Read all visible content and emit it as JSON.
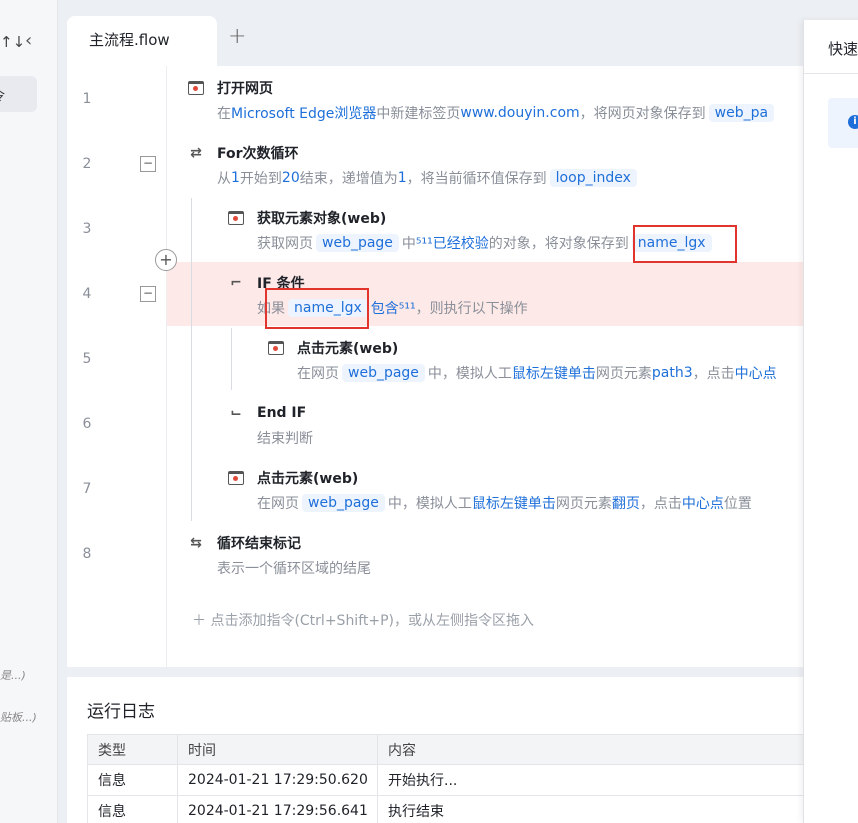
{
  "sidebar": {
    "sort_icon": "↑↓",
    "back_icon": "‹",
    "active_item": "令",
    "hint1": "是...)",
    "hint2": "贴板...)"
  },
  "tabs": [
    {
      "label": "主流程.flow"
    }
  ],
  "tab_add": "+",
  "steps": [
    {
      "line": "1",
      "title": "打开网页",
      "icon": "browser-open-icon",
      "desc": {
        "a": "在",
        "b": "Microsoft Edge浏览器",
        "c": "中新建标签页",
        "d": "www.douyin.com",
        "e": "，将网页对象保存到",
        "f": "web_pa"
      }
    },
    {
      "line": "2",
      "title": "For次数循环",
      "icon": "loop-icon",
      "desc": {
        "a": "从",
        "b": "1",
        "c": "开始到",
        "d": "20",
        "e": "结束，递增值为",
        "f": "1",
        "g": "，将当前循环值保存到",
        "h": "loop_index"
      }
    },
    {
      "line": "3",
      "title": "获取元素对象(web)",
      "icon": "web-element-icon",
      "desc": {
        "a": "获取网页",
        "b": "web_page",
        "c": "中",
        "d": "⁵¹¹已经校验",
        "e": "的对象，将对象保存到",
        "f": "name_lgx"
      }
    },
    {
      "line": "4",
      "title": "IF 条件",
      "icon": "if-condition-icon",
      "desc": {
        "a": "如果",
        "b": "name_lgx",
        "c": "包含⁵¹¹",
        "d": "，则执行以下操作"
      }
    },
    {
      "line": "5",
      "title": "点击元素(web)",
      "icon": "click-element-icon",
      "desc": {
        "a": "在网页",
        "b": "web_page",
        "c": "中，模拟人工",
        "d": "鼠标左键单击",
        "e": "网页元素",
        "f": "path3",
        "g": "，点击",
        "h": "中心点"
      }
    },
    {
      "line": "6",
      "title": "End IF",
      "icon": "end-if-icon",
      "desc": {
        "a": "结束判断"
      }
    },
    {
      "line": "7",
      "title": "点击元素(web)",
      "icon": "click-element-icon",
      "desc": {
        "a": "在网页",
        "b": "web_page",
        "c": "中，模拟人工",
        "d": "鼠标左键单击",
        "e": "网页元素",
        "f": "翻页",
        "g": "，点击",
        "h": "中心点",
        "i": "位置"
      }
    },
    {
      "line": "8",
      "title": "循环结束标记",
      "icon": "loop-end-icon",
      "desc": {
        "a": "表示一个循环区域的结尾"
      }
    }
  ],
  "fold_minus": "−",
  "add_step_circle": "+",
  "add_hint": "＋  点击添加指令(Ctrl+Shift+P)，或从左侧指令区拖入",
  "log": {
    "title": "运行日志",
    "columns": [
      "类型",
      "时间",
      "内容"
    ],
    "rows": [
      {
        "type": "信息",
        "time": "2024-01-21 17:29:50.620",
        "content": "开始执行..."
      },
      {
        "type": "信息",
        "time": "2024-01-21 17:29:56.641",
        "content": "执行结束"
      }
    ]
  },
  "right_panel": {
    "title": "快速",
    "info_icon": "i"
  },
  "colors": {
    "accent": "#1e6fd9",
    "highlight_row": "#fde9e7",
    "annotation_red": "#e0342d"
  }
}
